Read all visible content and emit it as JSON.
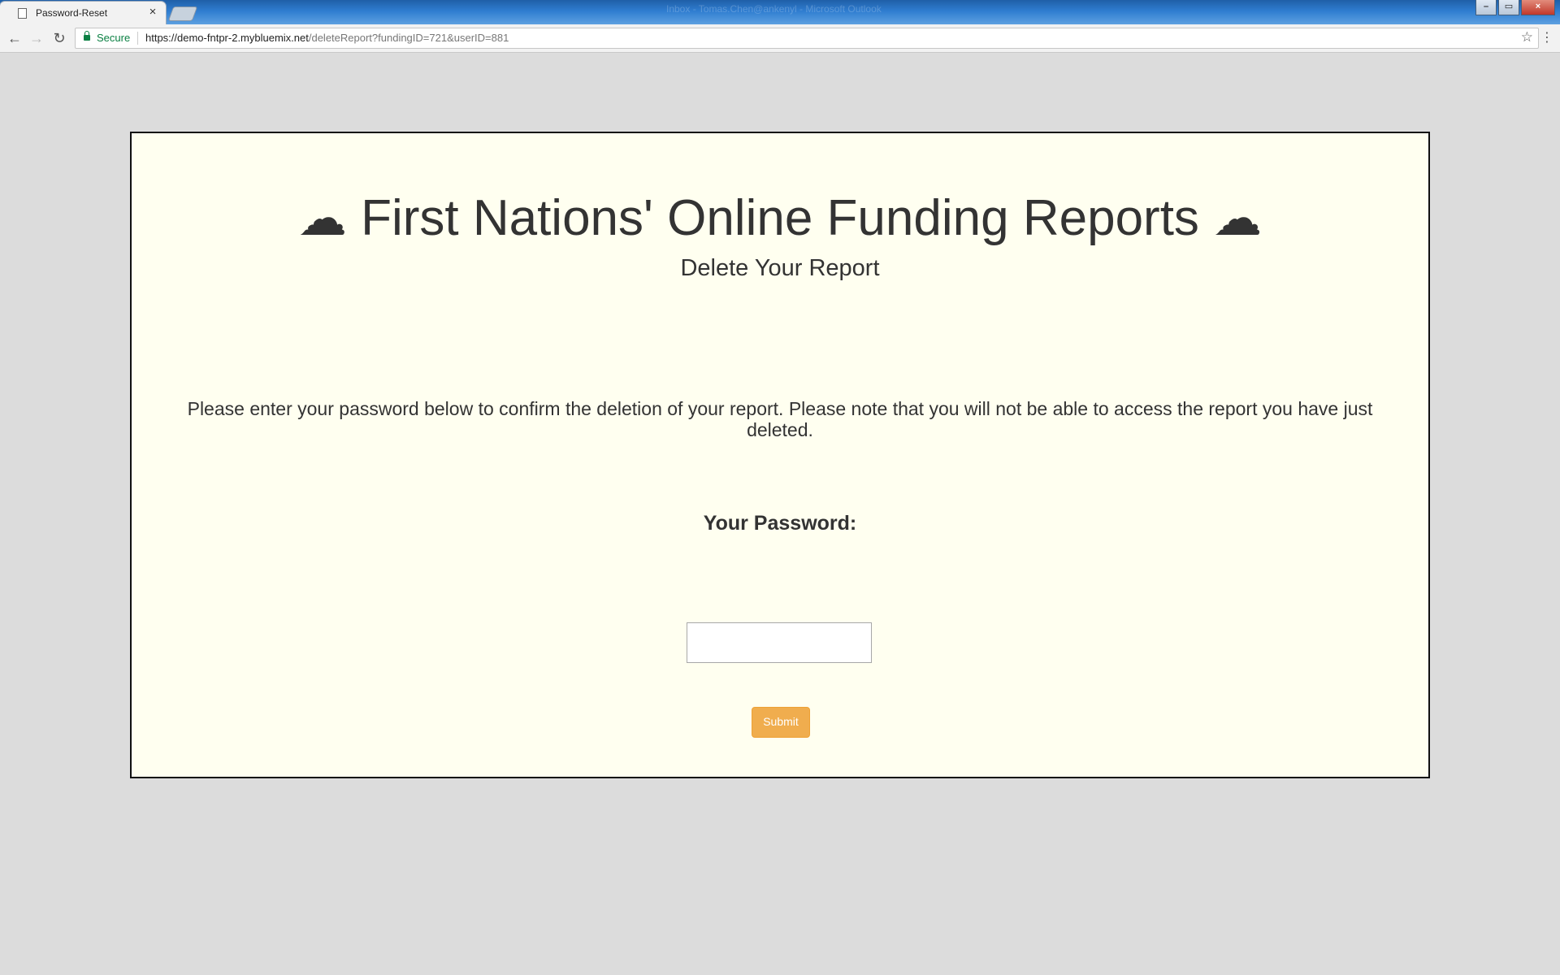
{
  "browser": {
    "tab_title": "Password-Reset",
    "tab_close": "×",
    "window_title": "Inbox - Tomas.Chen@ankenyl - Microsoft Outlook",
    "window_buttons": [
      "⎯",
      "▭",
      "×"
    ],
    "secure_label": "Secure",
    "url_host": "https://demo-fntpr-2.mybluemix.net",
    "url_path": "/deleteReport?fundingID=721&userID=881",
    "icons": {
      "back": "←",
      "forward": "→",
      "reload": "↻",
      "star": "☆",
      "menu": "⋮"
    }
  },
  "page": {
    "title": "First Nations' Online Funding Reports",
    "title_icon": "☁",
    "subtitle": "Delete Your Report",
    "instructions": "Please enter your password below to confirm the deletion of your report. Please note that you will not be able to access the report you have just deleted.",
    "password_label": "Your Password:",
    "password_value": "",
    "submit_label": "Submit"
  },
  "colors": {
    "panel_background": "#fffff0",
    "page_background": "#dcdcdc",
    "submit_button": "#f0ad4e",
    "secure_green": "#0b8043"
  }
}
